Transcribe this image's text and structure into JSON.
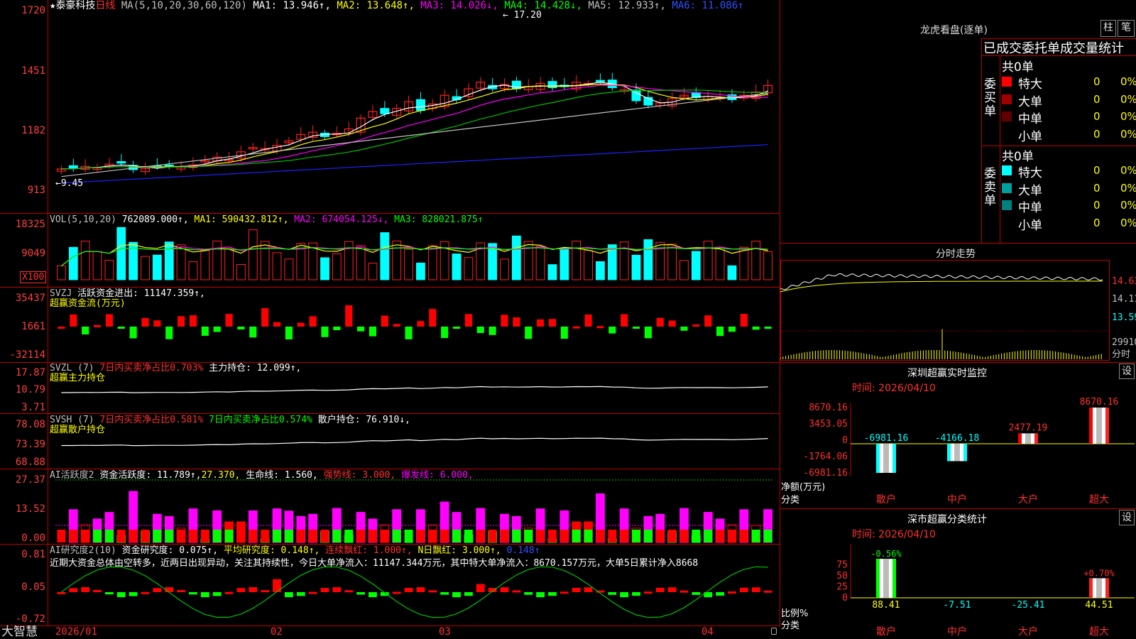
{
  "colors": {
    "up": "#ff2020",
    "down": "#00ffff",
    "grid": "#c00000",
    "ma1": "#ffffff",
    "ma2": "#ffff00",
    "ma3": "#ff00ff",
    "ma4": "#00c000",
    "ma5": "#c0c0c0",
    "ma6": "#2020ff"
  },
  "main": {
    "star": "★",
    "stock_name": "泰豪科技",
    "period": "日线",
    "ma_title": "MA(5,10,20,30,60,120)",
    "ma1": "MA1: 13.946↑,",
    "ma2": "MA2: 13.648↑,",
    "ma3": "MA3: 14.026↓,",
    "ma4": "MA4: 14.428↓,",
    "ma5": "MA5: 12.933↑,",
    "ma6": "MA6: 11.086↑",
    "y_ticks": [
      "1720",
      "1451",
      "1182",
      "913"
    ],
    "high_label": "17.20",
    "low_label": "9.45"
  },
  "vol": {
    "title": "VOL(5,10,20)",
    "value": "762089.000↑,",
    "ma1": "MA1: 590432.812↑,",
    "ma2": "MA2: 674054.125↓,",
    "ma3": "MA3: 828021.875↑",
    "y_ticks": [
      "18325",
      "9049"
    ],
    "unit": "X100"
  },
  "svzj": {
    "title": "SVZJ",
    "label": "活跃资金进出: 11147.359↑,",
    "sub": "超赢资金流(万元)",
    "y_ticks": [
      "35437",
      "1661",
      "-32114"
    ]
  },
  "svzl": {
    "title": "SVZL (7)",
    "label1": "7日内买卖净占比0.703%",
    "label2": "主力持仓: 12.099↑,",
    "sub": "超赢主力持仓",
    "y_ticks": [
      "17.87",
      "10.79",
      "3.71"
    ]
  },
  "svsh": {
    "title": "SVSH (7)",
    "label1": "7日内买卖净占比0.581%",
    "label2": "7日内买卖净占比0.574%",
    "label3": "散户持仓: 76.910↓,",
    "sub": "超赢散户持仓",
    "y_ticks": [
      "78.08",
      "73.39",
      "68.88"
    ]
  },
  "ai2": {
    "title": "AI活跃度2",
    "l1": "资金活跃度: 11.789↑,",
    "l2": "27.370,",
    "l3": "生命线: 1.560,",
    "l4": "强势线: 3.000,",
    "l5": "爆发线: 6.000,",
    "y_ticks": [
      "27.37",
      "13.52",
      "0.00"
    ]
  },
  "ai3": {
    "title": "AI研究度2(10)",
    "l1": "资金研究度: 0.075↑,",
    "l2": "平均研究度: 0.148↑,",
    "l3": "连续飘红: 1.000↑,",
    "l4": "N日飘红: 3.000↑,",
    "l5": "0.148↑",
    "note": "近期大资金总体由空转多，近两日出现异动，关注其持续性，今日大单净流入：11147.344万元，其中特大单净流入：8670.157万元，大单5日累计净入8668",
    "y_ticks": [
      "0.81",
      "0.05",
      "-0.72"
    ]
  },
  "xaxis": {
    "brand": "大智慧",
    "labels": [
      "2026/01",
      "02",
      "03",
      "04"
    ]
  },
  "longhu": {
    "title": "龙虎看盘(逐单)",
    "btn_bar": "柱",
    "btn_single": "笔",
    "header": "已成交委托单成交量统计",
    "buy_label": "委买单",
    "sell_label": "委卖单",
    "buy_total": "共0单",
    "sell_total": "共0单",
    "buy_rows": [
      {
        "name": "特大",
        "count": "0",
        "pct": "0%",
        "color": "#ff0000"
      },
      {
        "name": "大单",
        "count": "0",
        "pct": "0%",
        "color": "#a00000"
      },
      {
        "name": "中单",
        "count": "0",
        "pct": "0%",
        "color": "#600000"
      },
      {
        "name": "小单",
        "count": "0",
        "pct": "0%",
        "color": "#000000"
      }
    ],
    "sell_rows": [
      {
        "name": "特大",
        "count": "0",
        "pct": "0%",
        "color": "#00ffff"
      },
      {
        "name": "大单",
        "count": "0",
        "pct": "0%",
        "color": "#00a0a0"
      },
      {
        "name": "中单",
        "count": "0",
        "pct": "0%",
        "color": "#008080"
      },
      {
        "name": "小单",
        "count": "0",
        "pct": "0%",
        "color": "#000000"
      }
    ]
  },
  "intraday": {
    "title": "分时走势",
    "y_ticks": [
      "14.63",
      "14.11",
      "13.59",
      "29910"
    ],
    "unit": "分时"
  },
  "szmon": {
    "title": "深圳超赢实时监控",
    "btn": "设",
    "time": "时间: 2026/04/10",
    "y_ticks": [
      "8670.16",
      "3453.05",
      "0",
      "-1764.06",
      "-6981.16"
    ],
    "ylabel": "净额(万元)",
    "xlabel": "分类",
    "chart_data": {
      "type": "bar",
      "categories": [
        "散户",
        "中户",
        "大户",
        "超大"
      ],
      "values": [
        -6981.16,
        -4166.18,
        2477.19,
        8670.16
      ],
      "value_labels": [
        "-6981.16",
        "-4166.18",
        "2477.19",
        "8670.16"
      ],
      "ylim": [
        -6981.16,
        8670.16
      ]
    }
  },
  "szcls": {
    "title": "深市超赢分类统计",
    "btn": "设",
    "time": "时间: 2026/04/10",
    "y_ticks": [
      "75",
      "50",
      "25",
      "0"
    ],
    "ylabel": "比例%",
    "xlabel": "分类",
    "chart_data": {
      "type": "bar",
      "categories": [
        "散户",
        "中户",
        "大户",
        "超大"
      ],
      "values": [
        88.41,
        -7.51,
        -25.41,
        44.51
      ],
      "top_labels": [
        "-0.56%",
        "",
        "",
        "+0.70%"
      ],
      "value_labels": [
        "88.41",
        "-7.51",
        "-25.41",
        "44.51"
      ],
      "ylim": [
        0,
        100
      ]
    }
  }
}
